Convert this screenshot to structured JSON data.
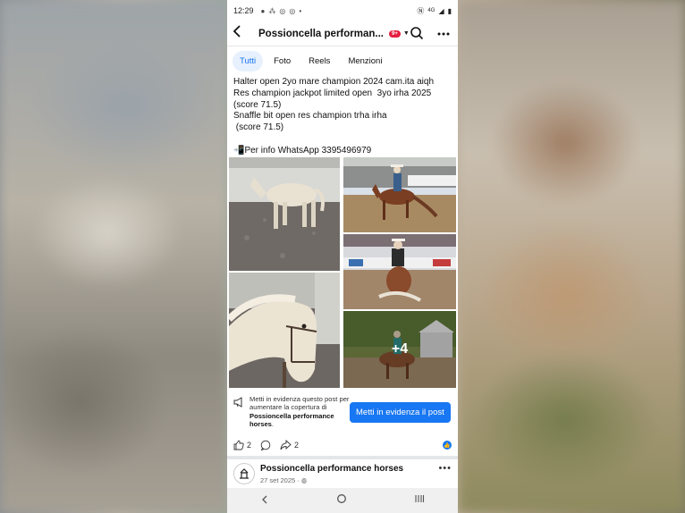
{
  "status_bar": {
    "time": "12:29",
    "notification_icons": [
      "chat-icon",
      "apps-icon",
      "instagram-icon",
      "instagram-icon",
      "dot"
    ],
    "network": "4G"
  },
  "header": {
    "title": "Possioncella performan...",
    "badge": "9+"
  },
  "tabs": [
    {
      "label": "Tutti",
      "active": true
    },
    {
      "label": "Foto",
      "active": false
    },
    {
      "label": "Reels",
      "active": false
    },
    {
      "label": "Menzioni",
      "active": false
    }
  ],
  "post": {
    "text": "Halter open 2yo mare champion 2024 cam.ita aiqh\nRes champion jackpot limited open  3yo irha 2025\n(score 71.5)\nSnaffle bit open res champion trha irha\n (score 71.5)\n\n📲Per info WhatsApp 3395496979",
    "more_photos": "+4"
  },
  "promo": {
    "text_1": "Metti in evidenza questo post per aumentare la copertura di",
    "page_name": "Possioncella performance horses",
    "text_2": ".",
    "button": "Metti in evidenza il post"
  },
  "actions": {
    "likes": "2",
    "shares": "2"
  },
  "next_post": {
    "author": "Possioncella performance horses",
    "date": "27 set 2025 ·"
  },
  "colors": {
    "accent": "#1877f2",
    "badge": "#e41e3f"
  }
}
